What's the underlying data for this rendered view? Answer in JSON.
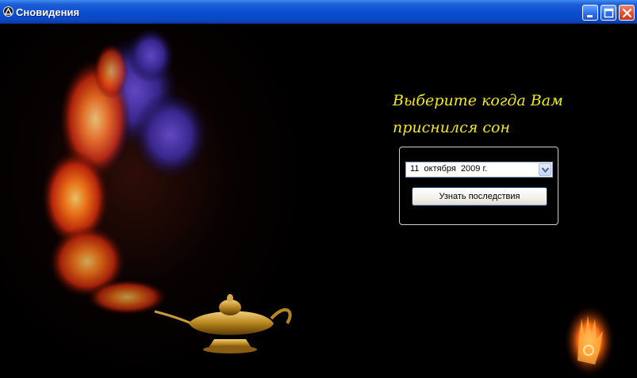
{
  "window": {
    "title": "Сновидения",
    "app_icon": "triangle-logo-icon",
    "controls": [
      "minimize-icon",
      "maximize-icon",
      "close-icon"
    ]
  },
  "main": {
    "prompt": "Выберите когда Вам\nприснился сон",
    "date_picker": {
      "value": "11  октября  2009 г.",
      "dropdown_icon": "chevron-down-icon"
    },
    "submit_label": "Узнать последствия"
  },
  "colors": {
    "titlebar": "#0a4ed0",
    "prompt_text": "#f3e81a",
    "background": "#000000",
    "close_button": "#e0512d"
  }
}
